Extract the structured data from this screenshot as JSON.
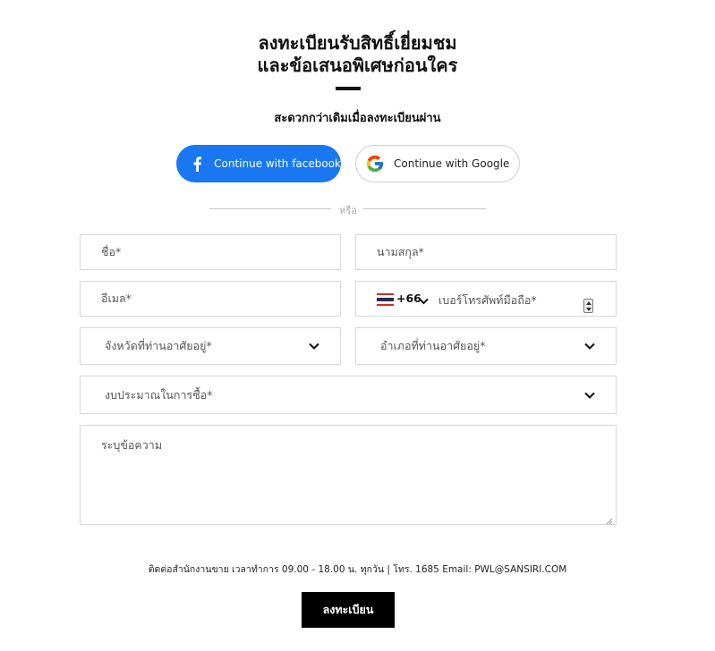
{
  "header": {
    "title_line1": "ลงทะเบียนรับสิทธิ์เยี่ยมชม",
    "title_line2": "และข้อเสนอพิเศษก่อนใคร",
    "subtitle": "สะดวกกว่าเดิมเมื่อลงทะเบียนผ่าน"
  },
  "social": {
    "facebook_label": "Continue with facebook",
    "google_label": "Continue with Google",
    "divider_text": "หรือ",
    "facebook_color": "#1a77f2"
  },
  "form": {
    "first_name_placeholder": "ชื่อ*",
    "last_name_placeholder": "นามสกุล*",
    "email_placeholder": "อีเมล*",
    "phone": {
      "country_flag": "thailand-flag-icon",
      "dial_code": "+66",
      "placeholder": "เบอร์โทรศัพท์มือถือ*"
    },
    "province_placeholder": "จังหวัดที่ท่านอาศัยอยู่*",
    "district_placeholder": "อำเภอที่ท่านอาศัยอยู่*",
    "budget_placeholder": "งบประมาณในการซื้อ*",
    "message_placeholder": "ระบุข้อความ"
  },
  "footer": {
    "contact_note": "ติดต่อสำนักงานขาย เวลาทำการ 09.00 - 18.00 น. ทุกวัน | โทร. 1685 Email: PWL@SANSIRI.COM",
    "submit_label": "ลงทะเบียน"
  }
}
